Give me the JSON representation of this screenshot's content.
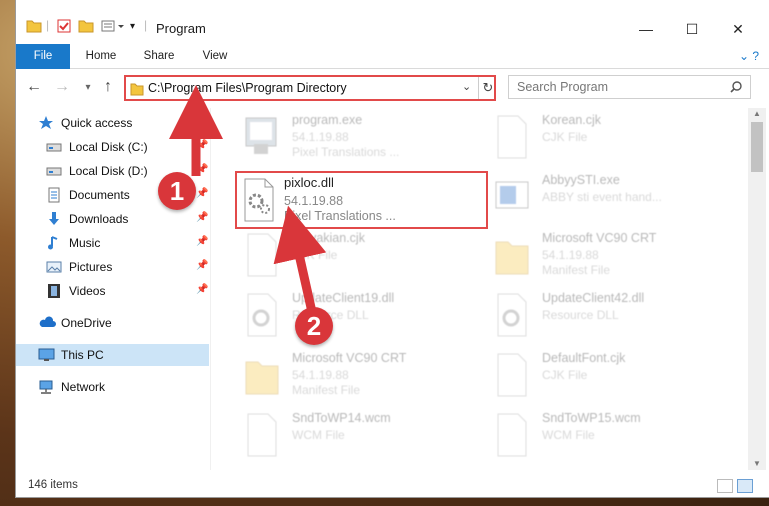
{
  "window": {
    "title": "Program",
    "controls": {
      "minimize": "—",
      "maximize": "☐",
      "close": "✕"
    }
  },
  "ribbon": {
    "tabs": [
      "File",
      "Home",
      "Share",
      "View"
    ]
  },
  "navigation": {
    "address_path": "C:\\Program Files\\Program Directory",
    "search_placeholder": "Search Program"
  },
  "sidebar": {
    "items": [
      {
        "label": "Quick access",
        "icon": "star-icon",
        "pinned": false
      },
      {
        "label": "Local Disk (C:)",
        "icon": "drive-icon",
        "pinned": true
      },
      {
        "label": "Local Disk (D:)",
        "icon": "drive-icon",
        "pinned": true
      },
      {
        "label": "Documents",
        "icon": "documents-icon",
        "pinned": true
      },
      {
        "label": "Downloads",
        "icon": "download-icon",
        "pinned": true
      },
      {
        "label": "Music",
        "icon": "music-icon",
        "pinned": true
      },
      {
        "label": "Pictures",
        "icon": "pictures-icon",
        "pinned": true
      },
      {
        "label": "Videos",
        "icon": "videos-icon",
        "pinned": true
      },
      {
        "label": "OneDrive",
        "icon": "cloud-icon",
        "pinned": false
      },
      {
        "label": "This PC",
        "icon": "computer-icon",
        "pinned": false,
        "selected": true
      },
      {
        "label": "Network",
        "icon": "network-icon",
        "pinned": false
      }
    ]
  },
  "files": {
    "highlighted": {
      "name": "pixloc.dll",
      "line1": "54.1.19.88",
      "line2": "Pixel Translations ..."
    },
    "left_column": [
      {
        "name": "program.exe",
        "line1": "54.1.19.88",
        "line2": "Pixel Translations ..."
      },
      {
        "name": "Slovakian.cjk",
        "line1": "CJK File",
        "line2": ""
      },
      {
        "name": "UpdateClient19.dll",
        "line1": "Resource DLL",
        "line2": ""
      },
      {
        "name": "Microsoft VC90 CRT",
        "line1": "54.1.19.88",
        "line2": "Manifest File"
      },
      {
        "name": "SndToWP14.wcm",
        "line1": "WCM File",
        "line2": ""
      }
    ],
    "right_column": [
      {
        "name": "Korean.cjk",
        "line1": "CJK File",
        "line2": ""
      },
      {
        "name": "AbbyySTI.exe",
        "line1": "ABBY sti event hand...",
        "line2": ""
      },
      {
        "name": "Microsoft VC90 CRT",
        "line1": "54.1.19.88",
        "line2": "Manifest File"
      },
      {
        "name": "UpdateClient42.dll",
        "line1": "Resource DLL",
        "line2": ""
      },
      {
        "name": "DefaultFont.cjk",
        "line1": "CJK File",
        "line2": ""
      },
      {
        "name": "SndToWP15.wcm",
        "line1": "WCM File",
        "line2": ""
      }
    ]
  },
  "status": {
    "item_count": "146 items"
  },
  "annotations": {
    "badge_1": "1",
    "badge_2": "2",
    "color": "#d9363a"
  }
}
